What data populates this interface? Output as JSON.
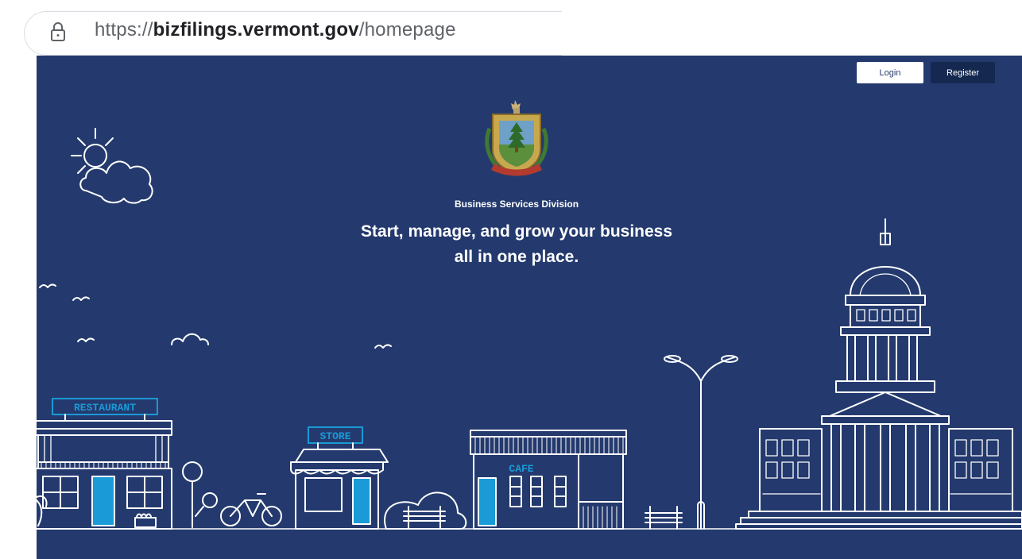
{
  "browser": {
    "url_prefix": "https://",
    "url_domain": "bizfilings.vermont.gov",
    "url_path": "/homepage"
  },
  "header": {
    "login_label": "Login",
    "register_label": "Register"
  },
  "hero": {
    "division": "Business Services Division",
    "headline_line1": "Start, manage, and grow your business",
    "headline_line2": "all in one place."
  },
  "illustration": {
    "restaurant_sign": "RESTAURANT",
    "store_sign": "STORE",
    "cafe_sign": "CAFE"
  },
  "colors": {
    "hero_background": "#243a6e",
    "register_button": "#15284f",
    "sign_accent": "#1a9ad6",
    "line_art": "#ffffff"
  }
}
